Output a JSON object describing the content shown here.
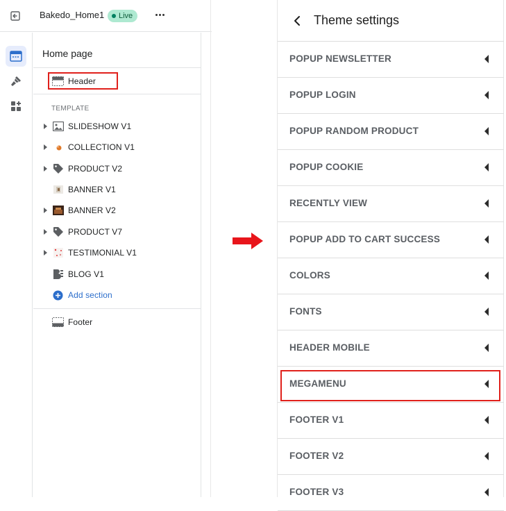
{
  "editor": {
    "store_name": "Bakedo_Home1",
    "live_badge": "Live",
    "panel_title": "Home page",
    "header_item": "Header",
    "template_label": "TEMPLATE",
    "sections": [
      {
        "label": "SLIDESHOW V1",
        "icon": "image-icon",
        "expandable": true
      },
      {
        "label": "COLLECTION V1",
        "icon": "collection-thumbnail-icon",
        "expandable": true
      },
      {
        "label": "PRODUCT V2",
        "icon": "tag-icon",
        "expandable": true
      },
      {
        "label": "BANNER V1",
        "icon": "banner-thumbnail-icon",
        "expandable": false
      },
      {
        "label": "BANNER V2",
        "icon": "banner-thumbnail-icon",
        "expandable": true
      },
      {
        "label": "PRODUCT V7",
        "icon": "tag-icon",
        "expandable": true
      },
      {
        "label": "TESTIMONIAL V1",
        "icon": "testimonial-thumbnail-icon",
        "expandable": true
      },
      {
        "label": "BLOG V1",
        "icon": "blog-icon",
        "expandable": false
      }
    ],
    "add_section": "Add section",
    "footer_item": "Footer"
  },
  "theme_settings": {
    "title": "Theme settings",
    "items": [
      "POPUP NEWSLETTER",
      "POPUP LOGIN",
      "POPUP RANDOM PRODUCT",
      "POPUP COOKIE",
      "RECENTLY VIEW",
      "POPUP ADD TO CART SUCCESS",
      "COLORS",
      "FONTS",
      "HEADER MOBILE",
      "MEGAMENU",
      "FOOTER V1",
      "FOOTER V2",
      "FOOTER V3"
    ]
  },
  "colors": {
    "highlight": "#e0201b",
    "arrow": "#e8151b",
    "accent_blue": "#2c6ecb",
    "live_badge_bg": "#aee9d1"
  }
}
